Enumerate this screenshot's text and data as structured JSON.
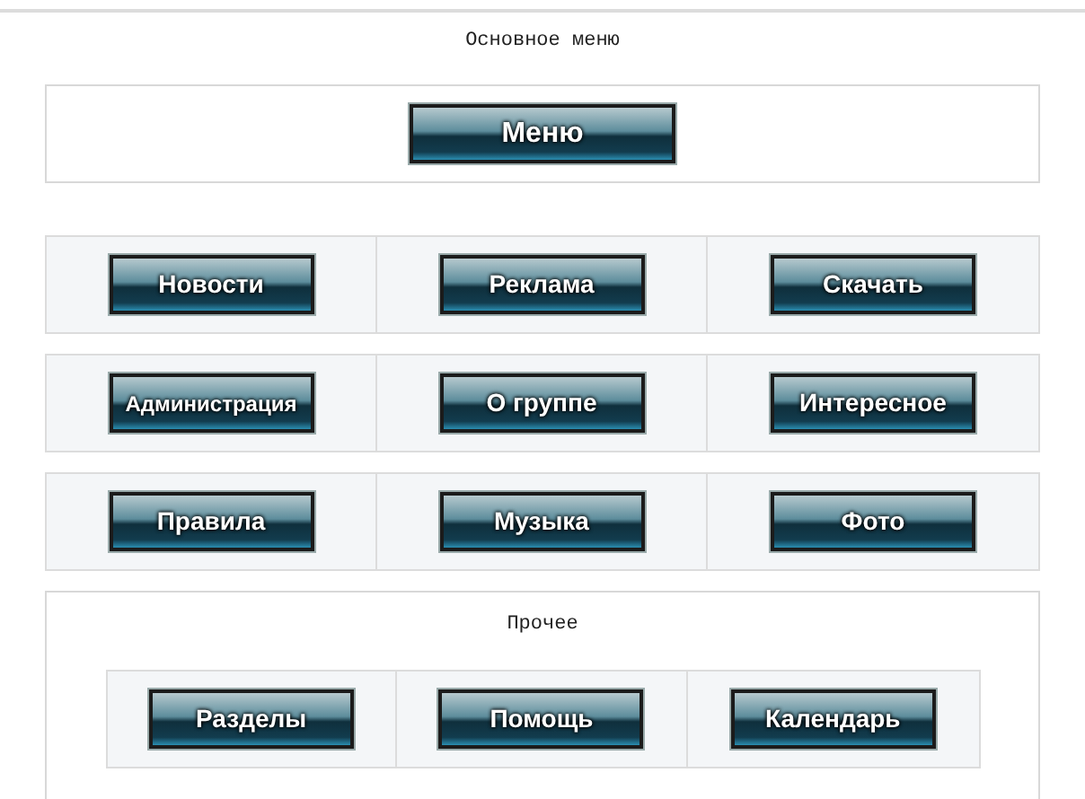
{
  "main_menu": {
    "title": "Основное меню",
    "header_button": "Меню",
    "rows": [
      [
        "Новости",
        "Реклама",
        "Скачать"
      ],
      [
        "Администрация",
        "О группе",
        "Интересное"
      ],
      [
        "Правила",
        "Музыка",
        "Фото"
      ]
    ]
  },
  "other": {
    "title": "Прочее",
    "buttons": [
      "Разделы",
      "Помощь",
      "Календарь"
    ]
  }
}
